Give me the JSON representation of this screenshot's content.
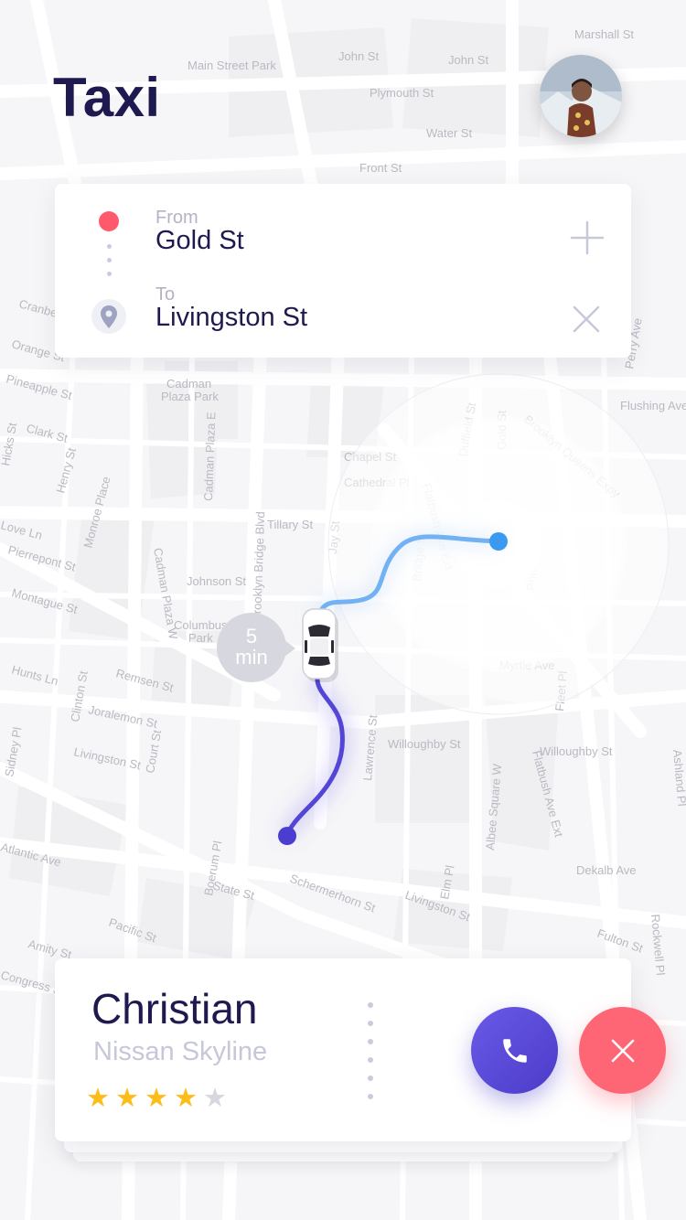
{
  "app": {
    "title": "Taxi"
  },
  "route": {
    "from_label": "From",
    "from_value": "Gold St",
    "to_label": "To",
    "to_value": "Livingston St"
  },
  "eta": {
    "value": "5",
    "unit": "min"
  },
  "driver": {
    "name": "Christian",
    "car": "Nissan Skyline",
    "rating": 4,
    "rating_max": 5
  },
  "map": {
    "streets": [
      "Marshall St",
      "John St",
      "John St",
      "Plymouth St",
      "Water St",
      "Front St",
      "Main Street Park",
      "Cadman Plaza Park",
      "Pineapple St",
      "Clark St",
      "Henry St",
      "Monroe Place",
      "Pierrepont St",
      "Montague St",
      "Cadman Plaza W",
      "Cadman Plaza E",
      "Tillary St",
      "Johnson St",
      "Columbus Park",
      "Chapel St",
      "Cathedral Pl",
      "Flatbush Ave Ext",
      "Brooklyn Queens Expy",
      "Duffield St",
      "Gold St",
      "Bridge St",
      "Prince St",
      "Myrtle Ave",
      "Fleet Pl",
      "Jay St",
      "Brooklyn Bridge Blvd",
      "Remsen St",
      "Joralemon St",
      "Hunts Ln",
      "Clinton St",
      "Livingston St",
      "Court St",
      "Lawrence St",
      "Willoughby St",
      "Willoughby St",
      "Albee Square W",
      "Flatbush Ave Ext",
      "Dekalb Ave",
      "Boerum Pl",
      "State St",
      "Schermerhorn St",
      "Livingston St",
      "Elm Pl",
      "Fulton St",
      "Atlantic Ave",
      "Pacific St",
      "Amity St",
      "Congress St",
      "Sidney Pl",
      "Rockwell Pl",
      "Ashland Pl",
      "Flushing Ave",
      "Perry Ave",
      "Orange St",
      "Cranberry St",
      "Love Ln",
      "Hicks St"
    ]
  },
  "colors": {
    "brand": "#1e1a4f",
    "accent": "#5b4bdb",
    "danger": "#ff5a6c",
    "route_start": "#3b9af0",
    "route_end": "#4c3dd1",
    "star_on": "#fbbd17",
    "star_off": "#d6d7e0"
  },
  "icons": {
    "call": "phone-icon",
    "cancel": "close-icon",
    "add": "plus-icon",
    "remove": "close-icon",
    "destination": "map-pin-icon",
    "origin": "red-dot-icon"
  }
}
